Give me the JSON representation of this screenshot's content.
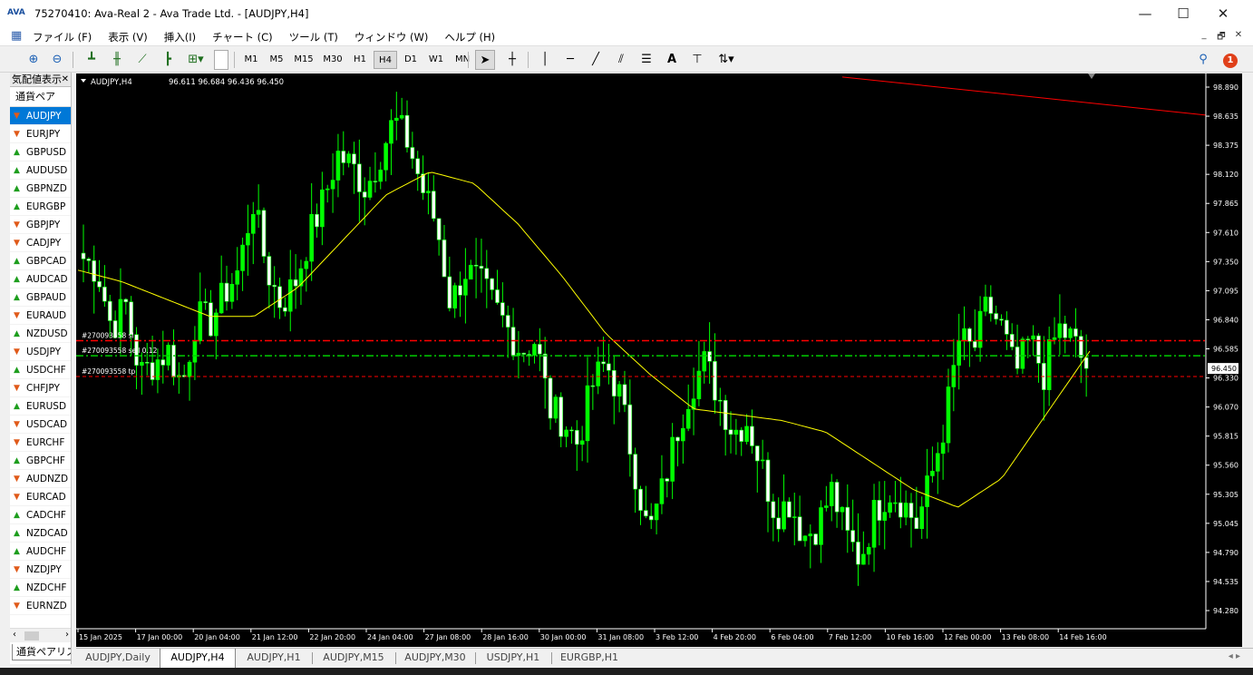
{
  "window": {
    "title": "75270410: Ava-Real 2 - Ava Trade Ltd. - [AUDJPY,H4]",
    "logo_text": "AVA",
    "controls": {
      "minimize": "—",
      "maximize": "☐",
      "close": "✕"
    }
  },
  "menu": {
    "items": [
      "ファイル (F)",
      "表示 (V)",
      "挿入(I)",
      "チャート (C)",
      "ツール (T)",
      "ウィンドウ (W)",
      "ヘルプ (H)"
    ],
    "mdi_controls": [
      "_",
      "🗗",
      "✕"
    ]
  },
  "toolbar": {
    "timeframes": [
      "M1",
      "M5",
      "M15",
      "M30",
      "H1",
      "H4",
      "D1",
      "W1",
      "MN"
    ],
    "active_timeframe": "H4",
    "notification_count": "1"
  },
  "market_watch": {
    "title": "気配値表示",
    "column_header": "通貨ペア",
    "tab_label": "通貨ペアリスト",
    "selected": "AUDJPY",
    "symbols": [
      {
        "name": "AUDJPY",
        "dir": "down"
      },
      {
        "name": "EURJPY",
        "dir": "down"
      },
      {
        "name": "GBPUSD",
        "dir": "up"
      },
      {
        "name": "AUDUSD",
        "dir": "up"
      },
      {
        "name": "GBPNZD",
        "dir": "up"
      },
      {
        "name": "EURGBP",
        "dir": "up"
      },
      {
        "name": "GBPJPY",
        "dir": "down"
      },
      {
        "name": "CADJPY",
        "dir": "down"
      },
      {
        "name": "GBPCAD",
        "dir": "up"
      },
      {
        "name": "AUDCAD",
        "dir": "up"
      },
      {
        "name": "GBPAUD",
        "dir": "up"
      },
      {
        "name": "EURAUD",
        "dir": "down"
      },
      {
        "name": "NZDUSD",
        "dir": "up"
      },
      {
        "name": "USDJPY",
        "dir": "down"
      },
      {
        "name": "USDCHF",
        "dir": "up"
      },
      {
        "name": "CHFJPY",
        "dir": "down"
      },
      {
        "name": "EURUSD",
        "dir": "up"
      },
      {
        "name": "USDCAD",
        "dir": "down"
      },
      {
        "name": "EURCHF",
        "dir": "down"
      },
      {
        "name": "GBPCHF",
        "dir": "up"
      },
      {
        "name": "AUDNZD",
        "dir": "down"
      },
      {
        "name": "EURCAD",
        "dir": "down"
      },
      {
        "name": "CADCHF",
        "dir": "up"
      },
      {
        "name": "NZDCAD",
        "dir": "up"
      },
      {
        "name": "AUDCHF",
        "dir": "up"
      },
      {
        "name": "NZDJPY",
        "dir": "down"
      },
      {
        "name": "NZDCHF",
        "dir": "up"
      },
      {
        "name": "EURNZD",
        "dir": "down"
      }
    ]
  },
  "chart_tabs": [
    "AUDJPY,Daily",
    "AUDJPY,H4",
    "AUDJPY,H1",
    "AUDJPY,M15",
    "AUDJPY,M30",
    "USDJPY,H1",
    "EURGBP,H1"
  ],
  "active_chart_tab": "AUDJPY,H4",
  "colors": {
    "bull": "#00ff00",
    "bear_fill": "#ffffff",
    "ma": "#ffff00",
    "sl_line": "#ff0000",
    "entry_line": "#00cc00",
    "current_price_box": "#ffffff"
  },
  "chart_data": {
    "type": "candlestick",
    "symbol_header": "AUDJPY,H4",
    "ohlc_header": "96.611 96.684 96.436 96.450",
    "current_price": 96.45,
    "current_price_label": "96.450",
    "ylim": [
      94.2,
      99.0
    ],
    "y_ticks": [
      "98.890",
      "98.635",
      "98.375",
      "98.120",
      "97.865",
      "97.610",
      "97.350",
      "97.095",
      "96.840",
      "96.585",
      "96.330",
      "96.070",
      "95.815",
      "95.560",
      "95.305",
      "95.045",
      "94.790",
      "94.535",
      "94.280"
    ],
    "x_ticks": [
      "15 Jan 2025",
      "17 Jan 00:00",
      "20 Jan 04:00",
      "21 Jan 12:00",
      "22 Jan 20:00",
      "24 Jan 04:00",
      "27 Jan 08:00",
      "28 Jan 16:00",
      "30 Jan 00:00",
      "31 Jan 08:00",
      "3 Feb 12:00",
      "4 Feb 20:00",
      "6 Feb 04:00",
      "7 Feb 12:00",
      "10 Feb 16:00",
      "12 Feb 00:00",
      "13 Feb 08:00",
      "14 Feb 16:00"
    ],
    "order_lines": [
      {
        "label": "#270093558 sl",
        "price": 96.69,
        "style": "sl"
      },
      {
        "label": "#270093558 sell 0.12",
        "price": 96.56,
        "style": "entry"
      },
      {
        "label": "#270093558 tp",
        "price": 96.38,
        "style": "tp"
      }
    ],
    "trendline": {
      "start": 98.97,
      "end": 98.64
    },
    "anchors": [
      97.4,
      97.3,
      96.8,
      97.0,
      96.4,
      96.5,
      96.6,
      96.3,
      96.9,
      96.85,
      97.1,
      97.3,
      97.9,
      97.3,
      97.0,
      97.2,
      97.6,
      97.9,
      98.3,
      98.2,
      98.0,
      98.3,
      98.6,
      98.4,
      98.0,
      97.7,
      97.0,
      97.3,
      97.2,
      97.0,
      96.8,
      96.6,
      96.7,
      96.1,
      96.0,
      95.8,
      96.3,
      96.5,
      96.2,
      95.6,
      95.0,
      95.4,
      95.9,
      96.3,
      96.5,
      96.2,
      95.9,
      96.0,
      95.6,
      95.2,
      95.3,
      95.0,
      95.1,
      95.4,
      95.0,
      94.8,
      95.2,
      95.4,
      95.3,
      95.1,
      95.5,
      96.0,
      96.7,
      96.6,
      97.0,
      96.8,
      96.4,
      96.7,
      96.4,
      96.8,
      96.7,
      96.45
    ],
    "ma_anchors": [
      97.3,
      97.2,
      97.05,
      96.9,
      96.9,
      97.15,
      97.55,
      97.95,
      98.15,
      98.05,
      97.7,
      97.25,
      96.75,
      96.4,
      96.1,
      96.05,
      96.0,
      95.9,
      95.65,
      95.4,
      95.25,
      95.5,
      96.05,
      96.6
    ]
  }
}
